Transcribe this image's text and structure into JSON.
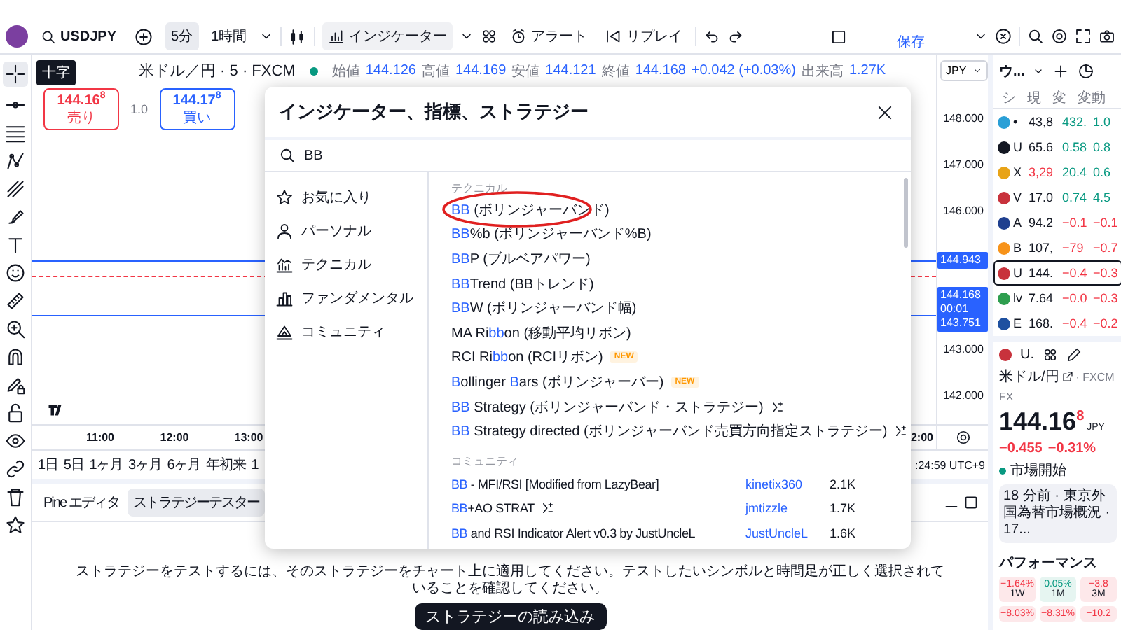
{
  "toolbar": {
    "symbol": "USDJPY",
    "intervals": [
      {
        "label": "5分",
        "selected": true
      },
      {
        "label": "1時間",
        "selected": false
      }
    ],
    "indicators": "インジケーター",
    "alerts": "アラート",
    "replay": "リプレイ",
    "save": "保存"
  },
  "tooltip": "十字",
  "legend": {
    "symbol": "米ドル／円 · 5 · FXCM",
    "values": [
      {
        "label": "始値",
        "value": "144.126"
      },
      {
        "label": "高値",
        "value": "144.169"
      },
      {
        "label": "安値",
        "value": "144.121"
      },
      {
        "label": "終値",
        "value": "144.168"
      }
    ],
    "change": "+0.042 (+0.03%)",
    "volume_label": "出来高",
    "volume": "1.27K"
  },
  "trade": {
    "sell": {
      "price": "144.16",
      "last_digit": "8",
      "label": "売り"
    },
    "spread": "1.0",
    "buy": {
      "price": "144.17",
      "last_digit": "8",
      "label": "買い"
    }
  },
  "price_axis": {
    "currency": "JPY",
    "ticks": [
      "148.000",
      "147.000",
      "146.000",
      "143.000",
      "142.000"
    ],
    "labels": [
      {
        "lines": [
          "144.943"
        ]
      },
      {
        "lines": [
          "144.168",
          "00:01",
          "143.751"
        ]
      }
    ]
  },
  "time_axis": {
    "ticks": [
      "11:00",
      "12:00",
      "13:00"
    ],
    "last_visible": "2:00"
  },
  "ranges": {
    "items": [
      "1日",
      "5日",
      "1ヶ月",
      "3ヶ月",
      "6ヶ月",
      "年初来",
      "1"
    ],
    "clock": ":24:59 UTC+9"
  },
  "bottom_panel": {
    "tabs": [
      {
        "label": "Pine エディタ",
        "selected": false
      },
      {
        "label": "ストラテジーテスター",
        "selected": true
      }
    ],
    "message": "ストラテジーをテストするには、そのストラテジーをチャート上に適用してください。テストしたいシンボルと時間足が正しく選択されていることを確認してください。",
    "button": "ストラテジーの読み込み"
  },
  "dialog": {
    "title": "インジケーター、指標、ストラテジー",
    "search": "BB",
    "categories": [
      {
        "label": "お気に入り",
        "kind": "star"
      },
      {
        "label": "パーソナル",
        "kind": "person"
      },
      {
        "label": "テクニカル",
        "kind": "technical"
      },
      {
        "label": "ファンダメンタル",
        "kind": "fundamental"
      },
      {
        "label": "コミュニティ",
        "kind": "community"
      }
    ],
    "technical_title": "テクニカル",
    "technical": [
      {
        "parts": [
          {
            "text": "BB",
            "match": true
          },
          {
            "text": " (ボリンジャーバンド)",
            "match": false
          }
        ],
        "strategy": false,
        "circled": true
      },
      {
        "parts": [
          {
            "text": "BB",
            "match": true
          },
          {
            "text": "%b (ボリンジャーバンド%B)",
            "match": false
          }
        ],
        "strategy": false,
        "circled": false
      },
      {
        "parts": [
          {
            "text": "BB",
            "match": true
          },
          {
            "text": "P (ブルベアパワー)",
            "match": false
          }
        ],
        "strategy": false,
        "circled": false
      },
      {
        "parts": [
          {
            "text": "BB",
            "match": true
          },
          {
            "text": "Trend (BBトレンド)",
            "match": false
          }
        ],
        "strategy": false,
        "circled": false
      },
      {
        "parts": [
          {
            "text": "BB",
            "match": true
          },
          {
            "text": "W (ボリンジャーバンド幅)",
            "match": false
          }
        ],
        "strategy": false,
        "circled": false
      },
      {
        "parts": [
          {
            "text": "MA Ri",
            "match": false
          },
          {
            "text": "bb",
            "match": true
          },
          {
            "text": "on (移動平均リボン)",
            "match": false
          }
        ],
        "strategy": false,
        "circled": false
      },
      {
        "parts": [
          {
            "text": "RCI Ri",
            "match": false
          },
          {
            "text": "bb",
            "match": true
          },
          {
            "text": "on (RCIリボン)",
            "match": false
          }
        ],
        "badge": "NEW",
        "strategy": false,
        "circled": false
      },
      {
        "parts": [
          {
            "text": "B",
            "match": true
          },
          {
            "text": "ollinger ",
            "match": false
          },
          {
            "text": "B",
            "match": true
          },
          {
            "text": "ars (ボリンジャーバー)",
            "match": false
          }
        ],
        "badge": "NEW",
        "strategy": false,
        "circled": false
      },
      {
        "parts": [
          {
            "text": "BB",
            "match": true
          },
          {
            "text": " Strategy (ボリンジャーバンド・ストラテジー)",
            "match": false
          }
        ],
        "strategy": true,
        "circled": false
      },
      {
        "parts": [
          {
            "text": "BB",
            "match": true
          },
          {
            "text": " Strategy directed (ボリンジャーバンド売買方向指定ストラテジー)",
            "match": false
          }
        ],
        "strategy": true,
        "circled": false
      }
    ],
    "community_title": "コミュニティ",
    "community": [
      {
        "parts": [
          {
            "text": "BB",
            "match": true
          },
          {
            "text": " - MFI/RSI [Modified from LazyBear]",
            "match": false
          }
        ],
        "strategy": false,
        "author": "kinetix360",
        "count": "2.1K"
      },
      {
        "parts": [
          {
            "text": "BB",
            "match": true
          },
          {
            "text": "+AO STRAT",
            "match": false
          }
        ],
        "strategy": true,
        "author": "jmtizzle",
        "count": "1.7K"
      },
      {
        "parts": [
          {
            "text": "BB",
            "match": true
          },
          {
            "text": " and RSI Indicator Alert v0.3 by JustUncleL",
            "match": false
          }
        ],
        "strategy": false,
        "author": "JustUncleL",
        "count": "1.6K"
      }
    ]
  },
  "watchlist": {
    "title": "ウ...",
    "columns": [
      "シ",
      "現",
      "変",
      "変動"
    ],
    "rows": [
      {
        "color": "#2a9fd6",
        "symbol": "•",
        "price": "43,8",
        "change": "432.",
        "change_pct": "1.0",
        "price_down": false,
        "down": false,
        "selected": false
      },
      {
        "color": "#131722",
        "symbol": "U",
        "price": "65.6",
        "change": "0.58",
        "change_pct": "0.8",
        "price_down": false,
        "down": false,
        "selected": false
      },
      {
        "color": "#e8a317",
        "symbol": "X",
        "price": "3,29",
        "change": "20.4",
        "change_pct": "0.6",
        "price_down": true,
        "down": false,
        "selected": false
      },
      {
        "color": "#c8323c",
        "symbol": "V",
        "price": "17.0",
        "change": "0.74",
        "change_pct": "4.5",
        "price_down": false,
        "down": false,
        "selected": false
      },
      {
        "color": "#1f3f8f",
        "symbol": "A",
        "price": "94.2",
        "change": "−0.1",
        "change_pct": "−0.1",
        "price_down": false,
        "down": true,
        "selected": false
      },
      {
        "color": "#f7931a",
        "symbol": "B",
        "price": "107,",
        "change": "−79",
        "change_pct": "−0.7",
        "price_down": false,
        "down": true,
        "selected": false
      },
      {
        "color": "#c8323c",
        "symbol": "U",
        "price": "144.",
        "change": "−0.4",
        "change_pct": "−0.3",
        "price_down": false,
        "down": true,
        "selected": true
      },
      {
        "color": "#2e9e4f",
        "symbol": "lv",
        "price": "7.64",
        "change": "−0.0",
        "change_pct": "−0.3",
        "price_down": false,
        "down": true,
        "selected": false
      },
      {
        "color": "#1e50a0",
        "symbol": "E",
        "price": "168.",
        "change": "−0.4",
        "change_pct": "−0.2",
        "price_down": false,
        "down": true,
        "selected": false
      }
    ]
  },
  "detail": {
    "symbol": "U.",
    "name": "米ドル/円",
    "exchange": "· FXCM",
    "type": "FX",
    "price": "144.16",
    "price_last": "8",
    "currency": "JPY",
    "change": "−0.455",
    "change_pct": "−0.31%",
    "status": "市場開始",
    "news": "18 分前 · 東京外国為替市場概況 · 17...",
    "performance_title": "パフォーマンス",
    "performance": [
      {
        "value": "−1.64%",
        "period": "1W",
        "down": true
      },
      {
        "value": "0.05%",
        "period": "1M",
        "down": false
      },
      {
        "value": "−3.8",
        "period": "3M",
        "down": true
      },
      {
        "value": "−8.03%",
        "down": true
      },
      {
        "value": "−8.31%",
        "down": true
      },
      {
        "value": "−10.2",
        "down": true
      }
    ]
  }
}
